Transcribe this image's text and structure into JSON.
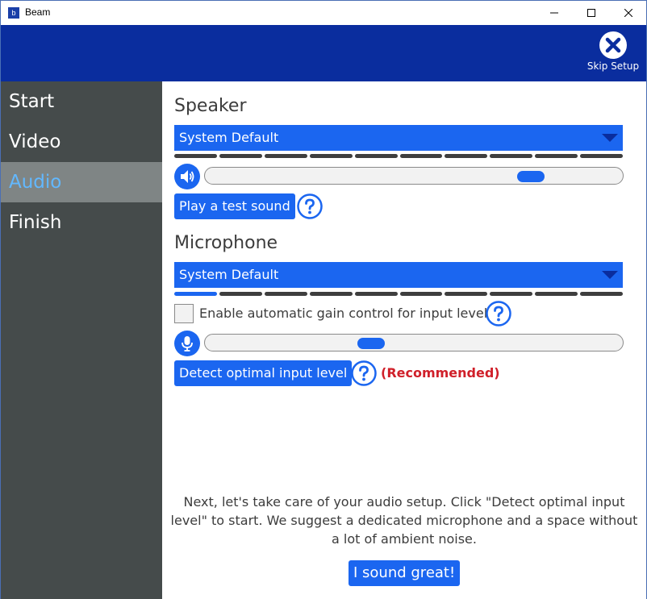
{
  "window": {
    "title": "Beam",
    "icon_label": "b"
  },
  "header": {
    "skip_label": "Skip Setup"
  },
  "sidebar": {
    "items": [
      {
        "label": "Start",
        "active": false
      },
      {
        "label": "Video",
        "active": false
      },
      {
        "label": "Audio",
        "active": true
      },
      {
        "label": "Finish",
        "active": false
      }
    ]
  },
  "speaker": {
    "title": "Speaker",
    "device": "System Default",
    "meter_active_segments": 0,
    "meter_total_segments": 10,
    "volume_fraction": 0.8,
    "test_button": "Play a test sound"
  },
  "microphone": {
    "title": "Microphone",
    "device": "System Default",
    "meter_active_segments": 1,
    "meter_total_segments": 10,
    "agc_label": "Enable automatic gain control for input level",
    "agc_checked": false,
    "gain_fraction": 0.39,
    "detect_button": "Detect optimal input level",
    "recommended": "(Recommended)"
  },
  "info_text": "Next, let's take care of your audio setup. Click \"Detect optimal input level\" to start. We suggest a dedicated microphone and a space without a lot of ambient noise.",
  "confirm_button": "I sound great!",
  "colors": {
    "accent": "#1b66f0",
    "header": "#0a2d9e",
    "sidebar": "#454b4b",
    "active_item_bg": "#7f8585",
    "active_item_text": "#62b8ff",
    "recommended": "#d0202a"
  },
  "icons": [
    "minimize-icon",
    "maximize-icon",
    "close-icon",
    "skip-close-icon",
    "speaker-icon",
    "microphone-icon",
    "help-icon",
    "dropdown-arrow-icon"
  ]
}
